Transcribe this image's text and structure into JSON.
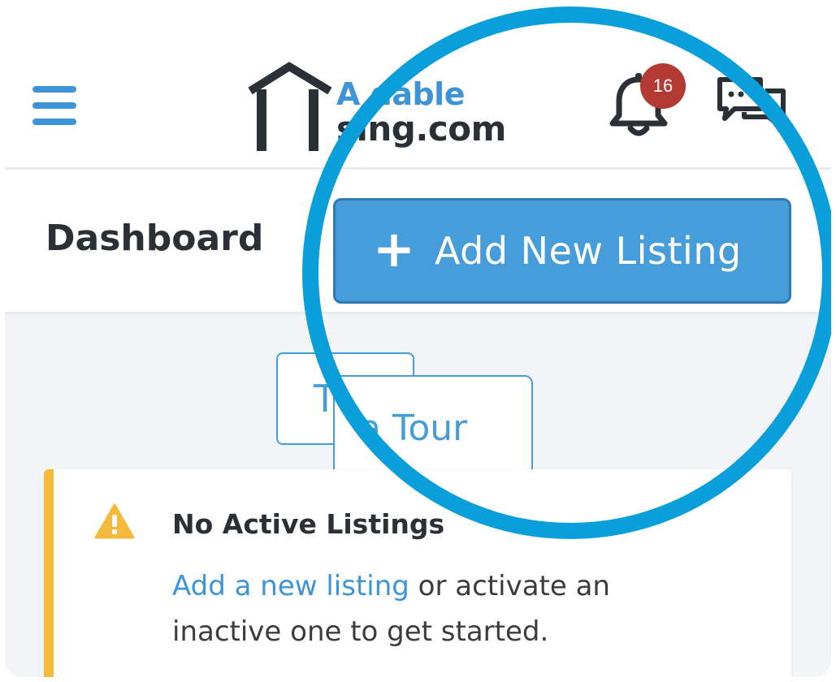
{
  "header": {
    "menu_icon": "hamburger-menu-icon",
    "logo": {
      "line1": "Affordable",
      "line2": "Housing.com",
      "visible_line1": "A dable",
      "visible_line2": "sing.com",
      "icon": "house-outline-icon",
      "line1_color": "#3d94d6",
      "line2_color": "#2b2f36"
    },
    "notifications": {
      "icon": "bell-icon",
      "count": "16"
    },
    "messages_icon": "chat-bubbles-icon"
  },
  "dashboard": {
    "title": "Dashboard",
    "add_button": {
      "icon": "plus-icon",
      "label": "Add New Listing"
    }
  },
  "tour": {
    "label_partial_top": "T",
    "label_visible": "a Tour"
  },
  "alert": {
    "icon": "warning-triangle-icon",
    "title": "No Active Listings",
    "link_text": "Add a new listing",
    "body_rest": " or activate an inactive one to get started."
  },
  "colors": {
    "accent": "#469dda",
    "warning": "#f5b93c",
    "badge": "#b33a32",
    "ring": "#0a9fdb",
    "page_bg": "#f2f4f7"
  }
}
